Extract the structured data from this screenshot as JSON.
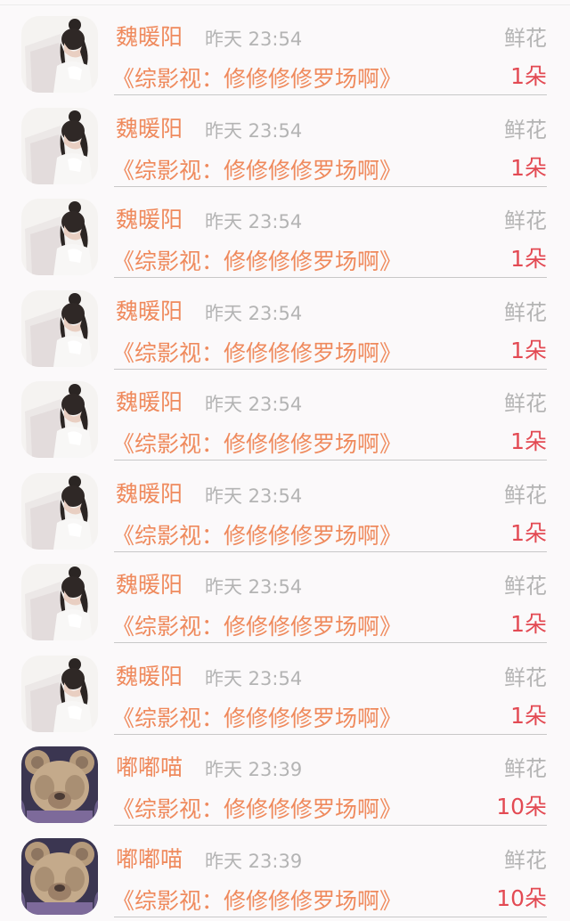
{
  "colors": {
    "background": "#fbf9fa",
    "name": "#ef8a5d",
    "book": "#ef8a5d",
    "muted": "#b4b4b4",
    "count": "#e34a53",
    "divider": "#c8c8c8"
  },
  "rows": [
    {
      "avatar_icon": "girl-avatar-icon",
      "name": "魏暖阳",
      "time": "昨天 23:54",
      "gift": "鲜花",
      "book": "《综影视：修修修修罗场啊》",
      "count": "1朵"
    },
    {
      "avatar_icon": "girl-avatar-icon",
      "name": "魏暖阳",
      "time": "昨天 23:54",
      "gift": "鲜花",
      "book": "《综影视：修修修修罗场啊》",
      "count": "1朵"
    },
    {
      "avatar_icon": "girl-avatar-icon",
      "name": "魏暖阳",
      "time": "昨天 23:54",
      "gift": "鲜花",
      "book": "《综影视：修修修修罗场啊》",
      "count": "1朵"
    },
    {
      "avatar_icon": "girl-avatar-icon",
      "name": "魏暖阳",
      "time": "昨天 23:54",
      "gift": "鲜花",
      "book": "《综影视：修修修修罗场啊》",
      "count": "1朵"
    },
    {
      "avatar_icon": "girl-avatar-icon",
      "name": "魏暖阳",
      "time": "昨天 23:54",
      "gift": "鲜花",
      "book": "《综影视：修修修修罗场啊》",
      "count": "1朵"
    },
    {
      "avatar_icon": "girl-avatar-icon",
      "name": "魏暖阳",
      "time": "昨天 23:54",
      "gift": "鲜花",
      "book": "《综影视：修修修修罗场啊》",
      "count": "1朵"
    },
    {
      "avatar_icon": "girl-avatar-icon",
      "name": "魏暖阳",
      "time": "昨天 23:54",
      "gift": "鲜花",
      "book": "《综影视：修修修修罗场啊》",
      "count": "1朵"
    },
    {
      "avatar_icon": "girl-avatar-icon",
      "name": "魏暖阳",
      "time": "昨天 23:54",
      "gift": "鲜花",
      "book": "《综影视：修修修修罗场啊》",
      "count": "1朵"
    },
    {
      "avatar_icon": "teddy-bear-avatar-icon",
      "name": "嘟嘟喵",
      "time": "昨天 23:39",
      "gift": "鲜花",
      "book": "《综影视：修修修修罗场啊》",
      "count": "10朵"
    },
    {
      "avatar_icon": "teddy-bear-avatar-icon",
      "name": "嘟嘟喵",
      "time": "昨天 23:39",
      "gift": "鲜花",
      "book": "《综影视：修修修修罗场啊》",
      "count": "10朵"
    }
  ]
}
